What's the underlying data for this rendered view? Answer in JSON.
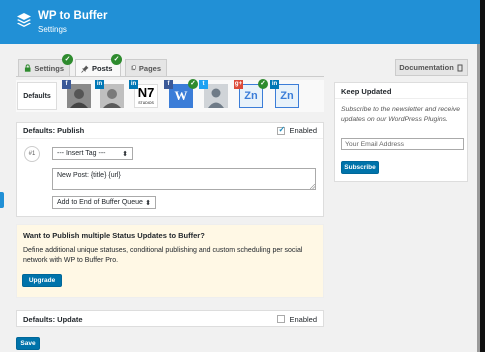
{
  "header": {
    "title": "WP to Buffer",
    "subtitle": "Settings"
  },
  "tabs": [
    {
      "label": "Settings",
      "icon": "lock-icon"
    },
    {
      "label": "Posts",
      "icon": "pin-icon"
    },
    {
      "label": "Pages",
      "icon": "pages-icon"
    }
  ],
  "documentation_label": "Documentation",
  "accounts": {
    "defaults_label": "Defaults",
    "list": [
      {
        "network": "facebook",
        "badge": "f",
        "color": "#3b5998",
        "enabled": false
      },
      {
        "network": "linkedin",
        "badge": "in",
        "color": "#0077b5",
        "enabled": false
      },
      {
        "network": "linkedin",
        "badge": "in",
        "color": "#0077b5",
        "enabled": false
      },
      {
        "network": "facebook",
        "badge": "f",
        "color": "#3b5998",
        "enabled": true
      },
      {
        "network": "twitter",
        "badge": "t",
        "color": "#1da1f2",
        "enabled": false
      },
      {
        "network": "google",
        "badge": "g+",
        "color": "#dd4b39",
        "enabled": true
      },
      {
        "network": "linkedin",
        "badge": "in",
        "color": "#0077b5",
        "enabled": false
      }
    ],
    "avatar_text": {
      "n7": "N7",
      "n7_sub": "STUDIOS",
      "w": "W",
      "zn": "Zn"
    }
  },
  "publish": {
    "title": "Defaults: Publish",
    "enabled_label": "Enabled",
    "enabled": true,
    "index": "#1",
    "insert_tag": "--- Insert Tag ---",
    "content": "New Post: {title} {url}",
    "queue_option": "Add to End of Buffer Queue"
  },
  "promo": {
    "title": "Want to Publish multiple Status Updates to Buffer?",
    "body": "Define additional unique statuses, conditional publishing and custom scheduling per social network with WP to Buffer Pro.",
    "button": "Upgrade"
  },
  "update": {
    "title": "Defaults: Update",
    "enabled_label": "Enabled",
    "enabled": false
  },
  "save_label": "Save",
  "sidebar": {
    "title": "Keep Updated",
    "text": "Subscribe to the newsletter and receive updates on our WordPress Plugins.",
    "email_placeholder": "Your Email Address",
    "subscribe_label": "Subscribe"
  },
  "colors": {
    "header": "#2190d6",
    "button": "#0073aa",
    "check": "#2e8b2e",
    "promo_bg": "#fff8e5"
  }
}
